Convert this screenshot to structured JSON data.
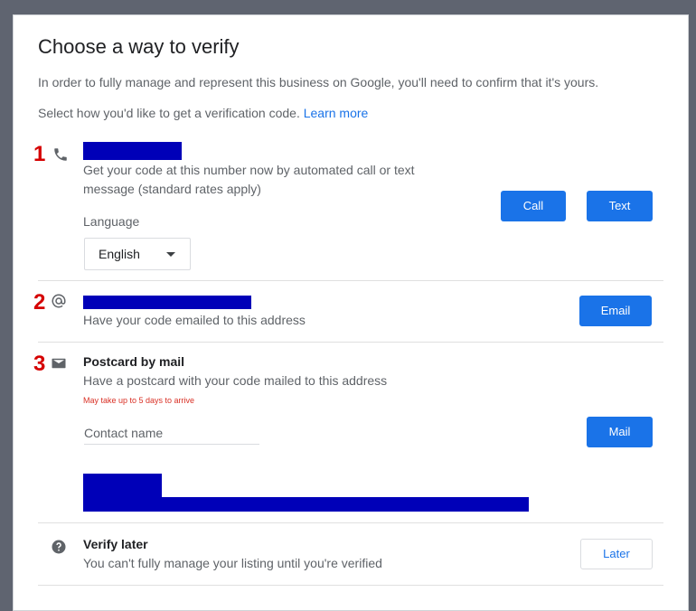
{
  "dialog": {
    "title": "Choose a way to verify",
    "intro": "In order to fully manage and represent this business on Google, you'll need to confirm that it's yours.",
    "select_text": "Select how you'd like to get a verification code.",
    "learn_more": "Learn more"
  },
  "phone": {
    "number_label": "1",
    "description_line1": "Get your code at this number now by automated call or text",
    "description_line2": "message (standard rates apply)",
    "language_label": "Language",
    "language_value": "English",
    "call_button": "Call",
    "text_button": "Text"
  },
  "email": {
    "number_label": "2",
    "description": "Have your code emailed to this address",
    "email_button": "Email"
  },
  "postcard": {
    "number_label": "3",
    "title": "Postcard by mail",
    "description": "Have a postcard with your code mailed to this address",
    "warning": "May take up to 5 days to arrive",
    "contact_placeholder": "Contact name",
    "mail_button": "Mail"
  },
  "later": {
    "title": "Verify later",
    "description": "You can't fully manage your listing until you're verified",
    "later_button": "Later"
  },
  "colors": {
    "accent": "#1a73e8",
    "annotation_red": "#d50000",
    "redaction": "#0000b8"
  },
  "icons": [
    "phone-icon",
    "at-sign-icon",
    "envelope-icon",
    "help-circle-icon",
    "caret-down-icon"
  ]
}
